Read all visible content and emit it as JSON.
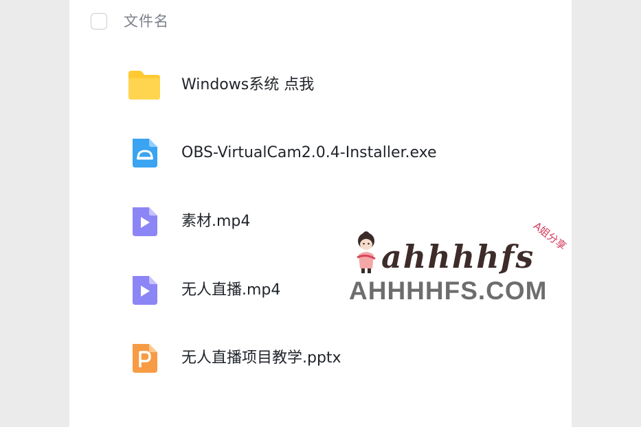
{
  "file_list": {
    "header": {
      "label": "文件名"
    },
    "items": [
      {
        "name": "Windows系统 点我",
        "icon": "folder-icon",
        "color": "#ffc933"
      },
      {
        "name": "OBS-VirtualCam2.0.4-Installer.exe",
        "icon": "exe-file-icon",
        "color": "#3aa3f2"
      },
      {
        "name": "素材.mp4",
        "icon": "video-file-icon",
        "color": "#8c85f5"
      },
      {
        "name": "无人直播.mp4",
        "icon": "video-file-icon",
        "color": "#8c85f5"
      },
      {
        "name": "无人直播项目教学.pptx",
        "icon": "pptx-file-icon",
        "color": "#f79b45"
      }
    ]
  },
  "watermark": {
    "script_text": "ahhhhfs",
    "domain_text": "AHHHHFS.COM",
    "tag_text": "A姐分享"
  },
  "colors": {
    "background": "#ebebeb",
    "panel": "#ffffff",
    "text": "#1f2329",
    "muted": "#7a7f8a"
  }
}
